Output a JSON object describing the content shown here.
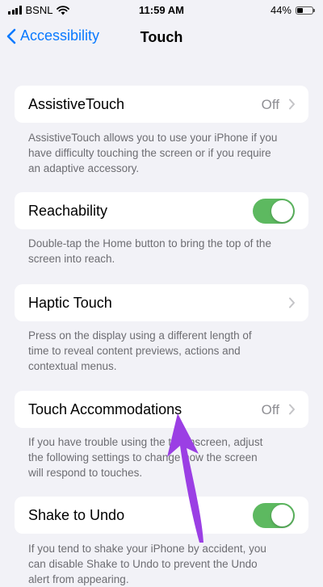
{
  "status_bar": {
    "carrier": "BSNL",
    "time": "11:59 AM",
    "battery_percent": "44%",
    "battery_level": 0.44,
    "icons": [
      "signal-icon",
      "wifi-icon",
      "battery-icon"
    ]
  },
  "nav": {
    "back_label": "Accessibility",
    "title": "Touch",
    "accent_color": "#0a7aff"
  },
  "settings": [
    {
      "label": "AssistiveTouch",
      "value": "Off",
      "control": "chevron",
      "footer": [
        "AssistiveTouch allows you to use your iPhone if you",
        "have difficulty touching the screen or if you require",
        "an adaptive accessory."
      ]
    },
    {
      "label": "Reachability",
      "control": "toggle",
      "on": true,
      "footer": [
        "Double-tap the Home button to bring the top of the",
        "screen into reach."
      ]
    },
    {
      "label": "Haptic Touch",
      "control": "chevron",
      "footer": [
        "Press on the display using a different length of",
        "time to reveal content previews, actions and",
        "contextual menus."
      ]
    },
    {
      "label": "Touch Accommodations",
      "value": "Off",
      "control": "chevron",
      "footer": [
        "If you have trouble using the touchscreen, adjust",
        "the following settings to change how the screen",
        "will respond to touches."
      ]
    },
    {
      "label": "Shake to Undo",
      "control": "toggle",
      "on": true,
      "footer": [
        "If you tend to shake your iPhone by accident, you",
        "can disable Shake to Undo to prevent the Undo",
        "alert from appearing."
      ]
    }
  ],
  "colors": {
    "toggle_on": "#5db960",
    "annotation_arrow": "#9b3fe4",
    "background": "#f2f2f7"
  }
}
